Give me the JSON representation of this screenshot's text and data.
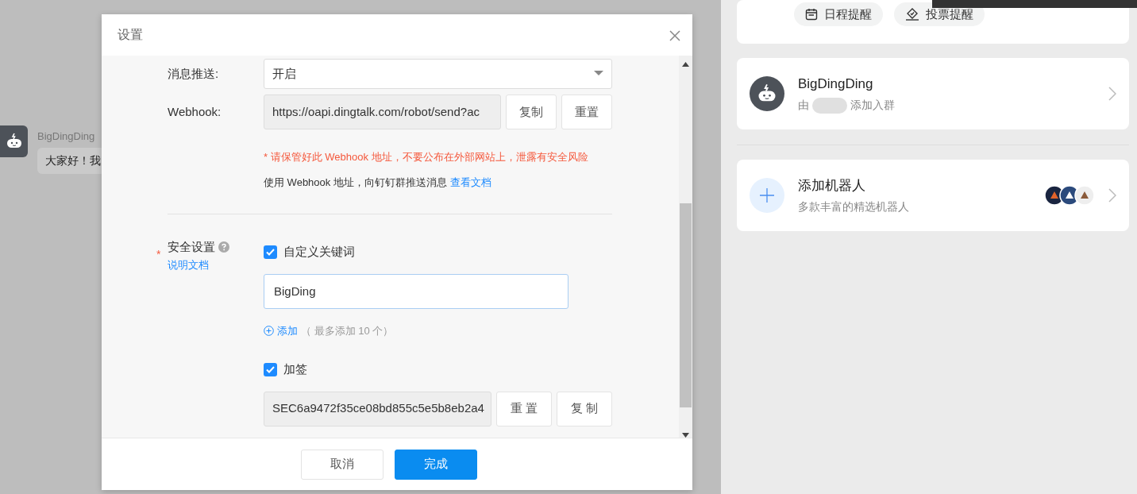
{
  "background_chat": {
    "sender": "BigDingDing",
    "message": "大家好！我"
  },
  "dialog": {
    "title": "设置",
    "fields": [
      {
        "kind": "select",
        "label": "消息推送:",
        "value": "开启"
      },
      {
        "kind": "readonly",
        "label": "Webhook:",
        "value": "https://oapi.dingtalk.com/robot/send?ac",
        "buttons": [
          "复制",
          "重置"
        ]
      }
    ],
    "warning": "* 请保管好此 Webhook 地址，不要公布在外部网站上，泄露有安全风险",
    "info": {
      "text": "使用 Webhook 地址，向钉钉群推送消息",
      "link": "查看文档"
    },
    "security": {
      "label": "安全设置",
      "required_mark": "*",
      "help_link": "说明文档",
      "options": [
        {
          "kind": "keywords",
          "label": "自定义关键词",
          "checked": true,
          "keywords": [
            "BigDing"
          ],
          "add_link": "添加",
          "add_hint": "（ 最多添加 10 个）"
        },
        {
          "kind": "sign",
          "label": "加签",
          "checked": true,
          "secret": "SEC6a9472f35ce08bd855c5e5b8eb2a4",
          "buttons": [
            "重 置",
            "复 制"
          ]
        }
      ]
    },
    "footer_buttons": [
      {
        "kind": "secondary",
        "label": "取消"
      },
      {
        "kind": "primary",
        "label": "完成"
      }
    ]
  },
  "side": {
    "chips": [
      {
        "kind": "calendar",
        "label": "日程提醒"
      },
      {
        "kind": "vote",
        "label": "投票提醒"
      }
    ],
    "robot": {
      "name": "BigDingDing",
      "subtitle_prefix": "由",
      "subtitle_suffix": "添加入群"
    },
    "add_robot": {
      "title": "添加机器人",
      "subtitle": "多款丰富的精选机器人"
    }
  }
}
